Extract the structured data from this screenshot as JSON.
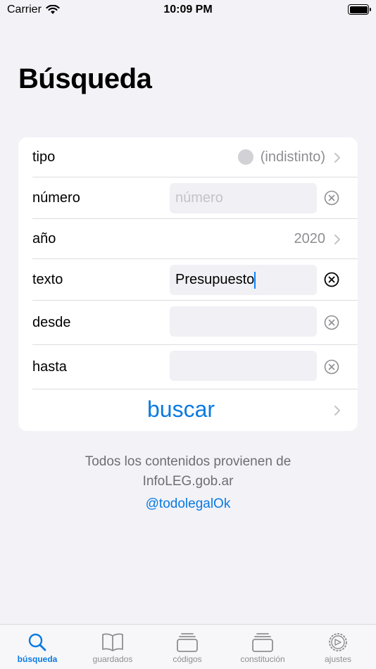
{
  "status": {
    "carrier": "Carrier",
    "time": "10:09 PM"
  },
  "title": "Búsqueda",
  "form": {
    "tipo": {
      "label": "tipo",
      "value": "(indistinto)"
    },
    "numero": {
      "label": "número",
      "placeholder": "número",
      "value": ""
    },
    "anio": {
      "label": "año",
      "value": "2020"
    },
    "texto": {
      "label": "texto",
      "value": "Presupuesto"
    },
    "desde": {
      "label": "desde",
      "value": ""
    },
    "hasta": {
      "label": "hasta",
      "value": ""
    },
    "buscar": "buscar"
  },
  "footer": {
    "line1": "Todos los contenidos provienen de",
    "line2": "InfoLEG.gob.ar",
    "handle": "@todolegalOk"
  },
  "tabs": [
    {
      "label": "búsqueda",
      "icon": "search-icon",
      "active": true
    },
    {
      "label": "guardados",
      "icon": "book-icon",
      "active": false
    },
    {
      "label": "códigos",
      "icon": "stack-icon",
      "active": false
    },
    {
      "label": "constitución",
      "icon": "stack-icon",
      "active": false
    },
    {
      "label": "ajustes",
      "icon": "gear-icon",
      "active": false
    }
  ],
  "colors": {
    "accent": "#0a7ae0",
    "background": "#f2f2f7",
    "card": "#ffffff",
    "secondary_text": "#8e8e93"
  }
}
